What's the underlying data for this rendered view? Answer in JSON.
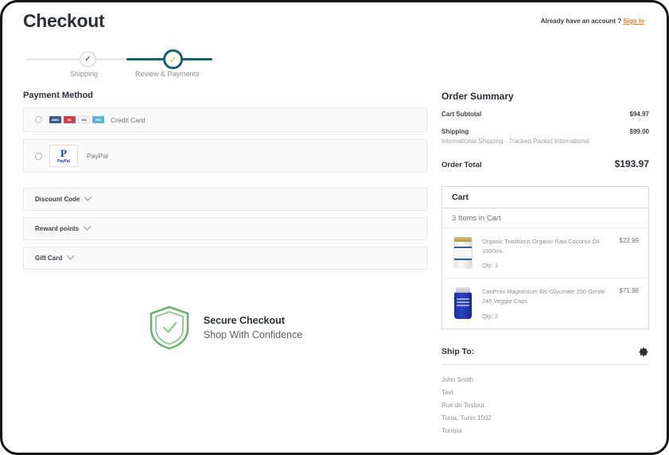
{
  "header": {
    "title": "Checkout",
    "account_prompt": "Already have an account ?",
    "signin_label": "Sign In"
  },
  "progress": {
    "steps": [
      {
        "label": "Shipping",
        "state": "done"
      },
      {
        "label": "Review & Payments",
        "state": "active"
      }
    ],
    "active_color": "#15606b",
    "check_color": "#a6ce39"
  },
  "payment": {
    "section_title": "Payment Method",
    "methods": [
      {
        "label": "Credit Card",
        "selected": false,
        "cards": [
          {
            "name": "amex-card-icon",
            "text": "AMEX"
          },
          {
            "name": "mastercard-card-icon",
            "text": "MC"
          },
          {
            "name": "visa-card-icon",
            "text": "VISA"
          },
          {
            "name": "discover-card-icon",
            "text": "DISC"
          }
        ]
      },
      {
        "label": "PayPal",
        "selected": false,
        "logo_mark": "P",
        "logo_word": "PayPal"
      }
    ]
  },
  "accordions": [
    {
      "label": "Discount Code"
    },
    {
      "label": "Reward points"
    },
    {
      "label": "Gift Card"
    }
  ],
  "secure_badge": {
    "title": "Secure Checkout",
    "subtitle": "Shop With Confidence",
    "shield_color": "#6cb26f"
  },
  "order_summary": {
    "title": "Order Summary",
    "subtotal_label": "Cart Subtotal",
    "subtotal_value": "$94.97",
    "shipping_label": "Shipping",
    "shipping_value": "$99.00",
    "shipping_method": "International Shipping - Tracked Packet International",
    "total_label": "Order Total",
    "total_value": "$193.97"
  },
  "cart": {
    "title": "Cart",
    "count_label": "3 Items in Cart",
    "items": [
      {
        "name": "Organic Traditions Organic Raw Coconut Oil 1000mL",
        "qty_label": "Qty: 1",
        "price": "$22.99",
        "thumb": "coconut-oil-jar"
      },
      {
        "name": "CanPrev Magnesium Bis-Glycinate 200 Gentle 240 Veggie Caps",
        "qty_label": "Qty: 2",
        "price": "$71.98",
        "thumb": "supplement-bottle"
      }
    ]
  },
  "ship_to": {
    "title": "Ship To:",
    "lines": [
      "John Smith",
      "Test",
      "Rue de Testour",
      "Tunis, Tunis 1002",
      "Tunisia"
    ]
  }
}
